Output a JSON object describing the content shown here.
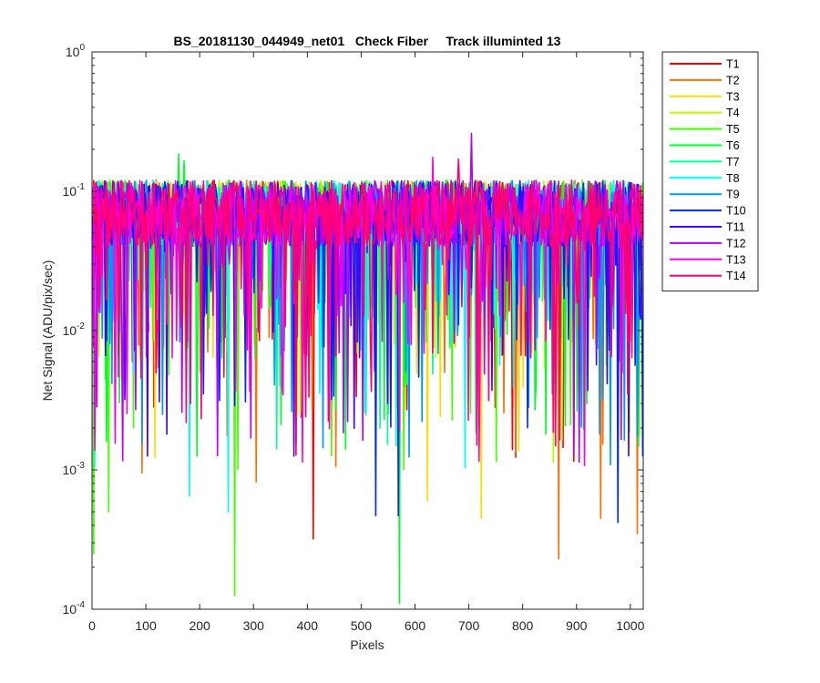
{
  "chart_data": {
    "type": "line",
    "title": "BS_20181130_044949_net01   Check Fiber     Track illuminted 13",
    "xlabel": "Pixels",
    "ylabel": "Net Signal (ADU/pix/sec)",
    "xlim": [
      0,
      1024
    ],
    "ylim": [
      0.0001,
      1
    ],
    "y_scale": "log",
    "grid": false,
    "legend_position": "outside-top-right",
    "x_ticks": [
      0,
      100,
      200,
      300,
      400,
      500,
      600,
      700,
      800,
      900,
      1000
    ],
    "y_ticks": [
      {
        "value": 0.0001,
        "base": "10",
        "exp": "-4"
      },
      {
        "value": 0.001,
        "base": "10",
        "exp": "-3"
      },
      {
        "value": 0.01,
        "base": "10",
        "exp": "-2"
      },
      {
        "value": 0.1,
        "base": "10",
        "exp": "-1"
      },
      {
        "value": 1,
        "base": "10",
        "exp": "0"
      }
    ],
    "series": [
      {
        "name": "T1",
        "color": "#ff0000"
      },
      {
        "name": "T2",
        "color": "#ff6e00"
      },
      {
        "name": "T3",
        "color": "#ffdc00"
      },
      {
        "name": "T4",
        "color": "#b4ff00"
      },
      {
        "name": "T5",
        "color": "#46ff00"
      },
      {
        "name": "T6",
        "color": "#00ff28"
      },
      {
        "name": "T7",
        "color": "#00ff96"
      },
      {
        "name": "T8",
        "color": "#00fff0"
      },
      {
        "name": "T9",
        "color": "#0096ff"
      },
      {
        "name": "T10",
        "color": "#0028ff"
      },
      {
        "name": "T11",
        "color": "#4600ff"
      },
      {
        "name": "T12",
        "color": "#b400ff"
      },
      {
        "name": "T13",
        "color": "#ff00dc"
      },
      {
        "name": "T14",
        "color": "#ff006e"
      }
    ],
    "series_profile": {
      "typical_value": 0.07,
      "typical_band": [
        0.04,
        0.12
      ],
      "dips": [
        {
          "series": "T2",
          "x": 92,
          "y": 0.00095
        },
        {
          "series": "T5",
          "x": 31,
          "y": 0.0005
        },
        {
          "series": "T5",
          "x": 265,
          "y": 0.000125
        },
        {
          "series": "T6",
          "x": 571,
          "y": 0.00011
        },
        {
          "series": "T5",
          "x": 2,
          "y": 0.00025
        },
        {
          "series": "T1",
          "x": 411,
          "y": 0.00032
        },
        {
          "series": "T2",
          "x": 867,
          "y": 0.00023
        },
        {
          "series": "T2",
          "x": 1013,
          "y": 0.00035
        },
        {
          "series": "T10",
          "x": 527,
          "y": 0.00047
        },
        {
          "series": "T10",
          "x": 568,
          "y": 0.00047
        },
        {
          "series": "T8",
          "x": 180,
          "y": 0.00065
        },
        {
          "series": "T8",
          "x": 253,
          "y": 0.0005
        },
        {
          "series": "T3",
          "x": 723,
          "y": 0.00045
        },
        {
          "series": "T10",
          "x": 977,
          "y": 0.00042
        },
        {
          "series": "T2",
          "x": 945,
          "y": 0.00045
        },
        {
          "series": "T3",
          "x": 623,
          "y": 0.0006
        },
        {
          "series": "T2",
          "x": 305,
          "y": 0.00082
        }
      ],
      "peaks": [
        {
          "series": "T12",
          "x": 704,
          "y": 0.26
        },
        {
          "series": "T6",
          "x": 161,
          "y": 0.185
        },
        {
          "series": "T6",
          "x": 171,
          "y": 0.165
        },
        {
          "series": "T13",
          "x": 632,
          "y": 0.175
        },
        {
          "series": "T14",
          "x": 680,
          "y": 0.17
        }
      ]
    }
  }
}
